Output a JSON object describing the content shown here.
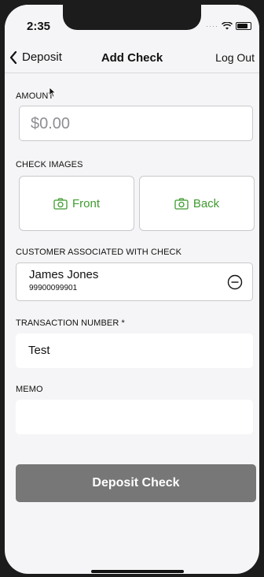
{
  "status_bar": {
    "time": "2:35"
  },
  "nav": {
    "back_label": "Deposit",
    "title": "Add Check",
    "logout_label": "Log Out"
  },
  "amount": {
    "label": "AMOUNT",
    "value": "$0.00"
  },
  "check_images": {
    "label": "CHECK IMAGES",
    "front_label": "Front",
    "back_label": "Back"
  },
  "customer": {
    "label": "CUSTOMER ASSOCIATED WITH CHECK",
    "name": "James Jones",
    "id": "99900099901"
  },
  "transaction": {
    "label": "TRANSACTION NUMBER *",
    "value": "Test"
  },
  "memo": {
    "label": "MEMO",
    "value": ""
  },
  "deposit": {
    "label": "Deposit Check"
  },
  "colors": {
    "accent": "#3f9b2f",
    "button_bg": "#777778"
  }
}
